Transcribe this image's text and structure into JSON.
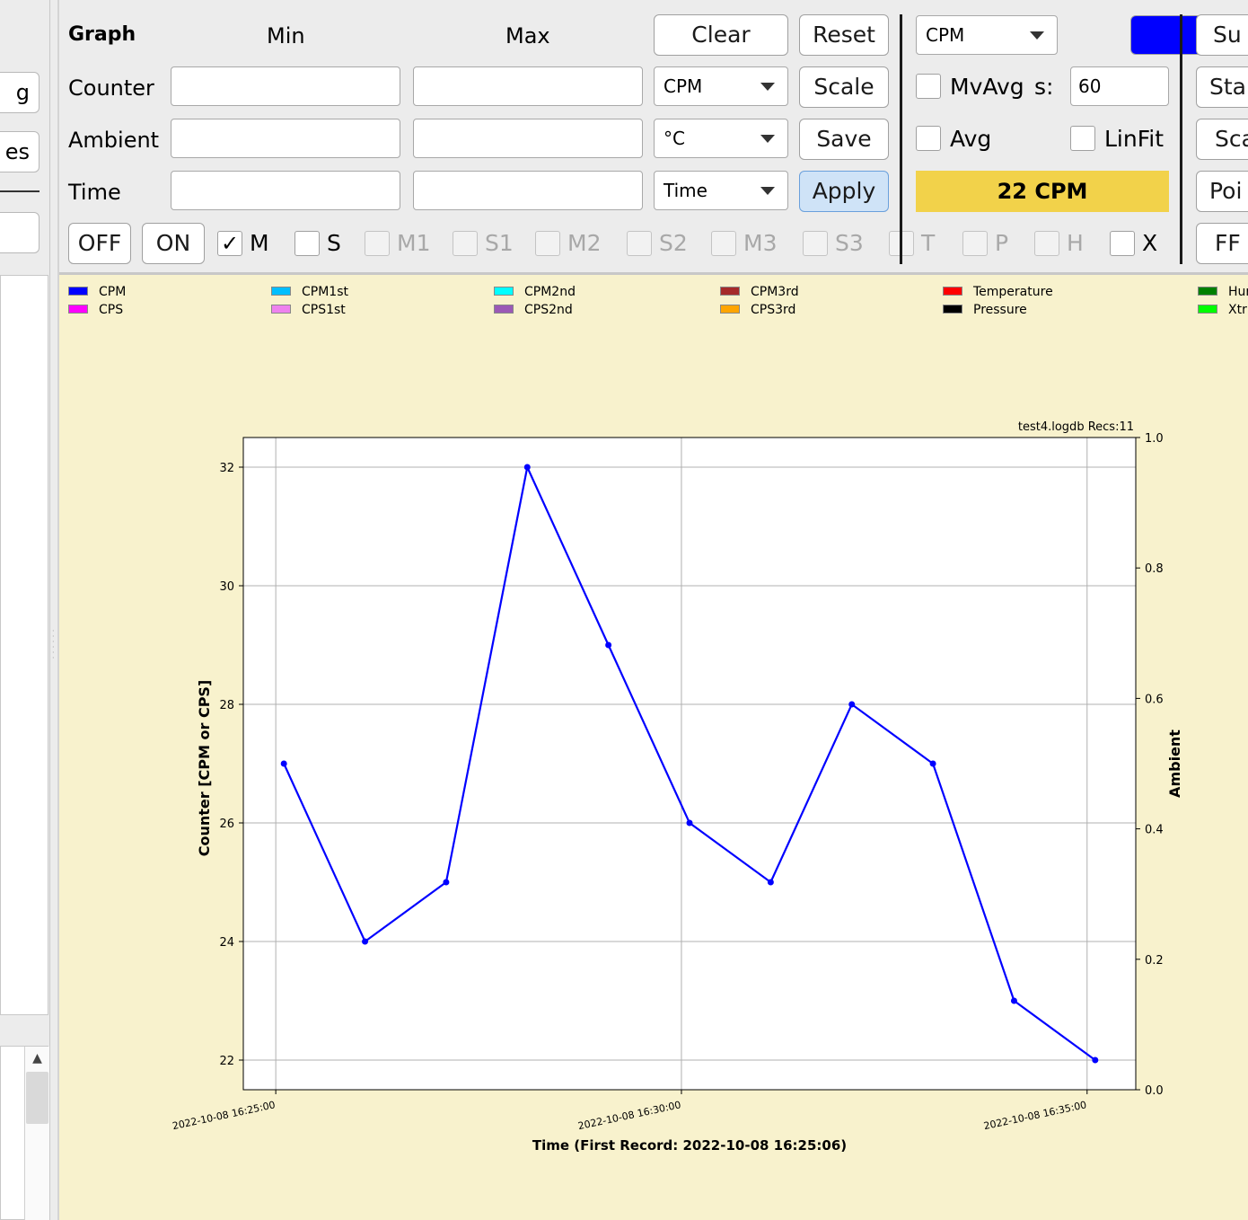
{
  "left_panel": {
    "buttons": [
      "g",
      "es",
      ""
    ]
  },
  "controls": {
    "header": {
      "graph": "Graph",
      "min": "Min",
      "max": "Max"
    },
    "rows": [
      {
        "label": "Counter",
        "min_value": "",
        "max_value": "",
        "unit": "CPM"
      },
      {
        "label": "Ambient",
        "min_value": "",
        "max_value": "",
        "unit": "°C"
      },
      {
        "label": "Time",
        "min_value": "",
        "max_value": "",
        "unit": "Time"
      }
    ],
    "buttons": {
      "clear": "Clear",
      "reset": "Reset",
      "scale": "Scale",
      "save": "Save",
      "apply": "Apply",
      "off": "OFF",
      "on": "ON"
    },
    "variable_select": "CPM",
    "variable_color": "#0000ff",
    "mvavg": {
      "label": "MvAvg",
      "s_label": "s:",
      "value": "60",
      "checked": false
    },
    "avg": {
      "label": "Avg",
      "checked": false
    },
    "linfit": {
      "label": "LinFit",
      "checked": false
    },
    "current_value": "22 CPM",
    "right_buttons": [
      "Su",
      "Sta",
      "Sca",
      "Poi",
      "FF"
    ],
    "checkboxes": [
      {
        "label": "M",
        "checked": true,
        "enabled": true
      },
      {
        "label": "S",
        "checked": false,
        "enabled": true
      },
      {
        "label": "M1",
        "checked": false,
        "enabled": false
      },
      {
        "label": "S1",
        "checked": false,
        "enabled": false
      },
      {
        "label": "M2",
        "checked": false,
        "enabled": false
      },
      {
        "label": "S2",
        "checked": false,
        "enabled": false
      },
      {
        "label": "M3",
        "checked": false,
        "enabled": false
      },
      {
        "label": "S3",
        "checked": false,
        "enabled": false
      },
      {
        "label": "T",
        "checked": false,
        "enabled": false
      },
      {
        "label": "P",
        "checked": false,
        "enabled": false
      },
      {
        "label": "H",
        "checked": false,
        "enabled": false
      },
      {
        "label": "X",
        "checked": false,
        "enabled": true
      }
    ],
    "check_glyph": "✓"
  },
  "legend": [
    {
      "label": "CPM",
      "color": "#0000ff"
    },
    {
      "label": "CPS",
      "color": "#ff00ff"
    },
    {
      "label": "CPM1st",
      "color": "#00bfff"
    },
    {
      "label": "CPS1st",
      "color": "#ee82ee"
    },
    {
      "label": "CPM2nd",
      "color": "#00ffff"
    },
    {
      "label": "CPS2nd",
      "color": "#9b59b6"
    },
    {
      "label": "CPM3rd",
      "color": "#a52a2a"
    },
    {
      "label": "CPS3rd",
      "color": "#ffa500"
    },
    {
      "label": "Temperature",
      "color": "#ff0000"
    },
    {
      "label": "Pressure",
      "color": "#000000"
    },
    {
      "label": "Hur",
      "color": "#008000"
    },
    {
      "label": "Xtr",
      "color": "#00ff00"
    }
  ],
  "chart_data": {
    "type": "line",
    "file_info": "test4.logdb   Recs:11",
    "xlabel": "Time (First Record: 2022-10-08 16:25:06)",
    "ylabel": "Counter  [CPM or CPS]",
    "y2label": "Ambient",
    "x_tick_labels": [
      "2022-10-08  16:25:00",
      "2022-10-08  16:30:00",
      "2022-10-08  16:35:00"
    ],
    "x_tick_minutes": [
      0,
      5,
      10
    ],
    "xlim_minutes": [
      -0.4,
      10.6
    ],
    "y_ticks": [
      22,
      24,
      26,
      28,
      30,
      32
    ],
    "ylim": [
      21.5,
      32.5
    ],
    "y2_ticks": [
      "0.0",
      "0.2",
      "0.4",
      "0.6",
      "0.8",
      "1.0"
    ],
    "y2lim": [
      0,
      1
    ],
    "grid": true,
    "series": [
      {
        "name": "CPM",
        "color": "#0000ff",
        "x_minutes": [
          0.1,
          1.1,
          2.1,
          3.1,
          4.1,
          5.1,
          6.1,
          7.1,
          8.1,
          9.1,
          10.1
        ],
        "values": [
          27,
          24,
          25,
          32,
          29,
          26,
          25,
          28,
          27,
          23,
          22
        ]
      }
    ]
  }
}
